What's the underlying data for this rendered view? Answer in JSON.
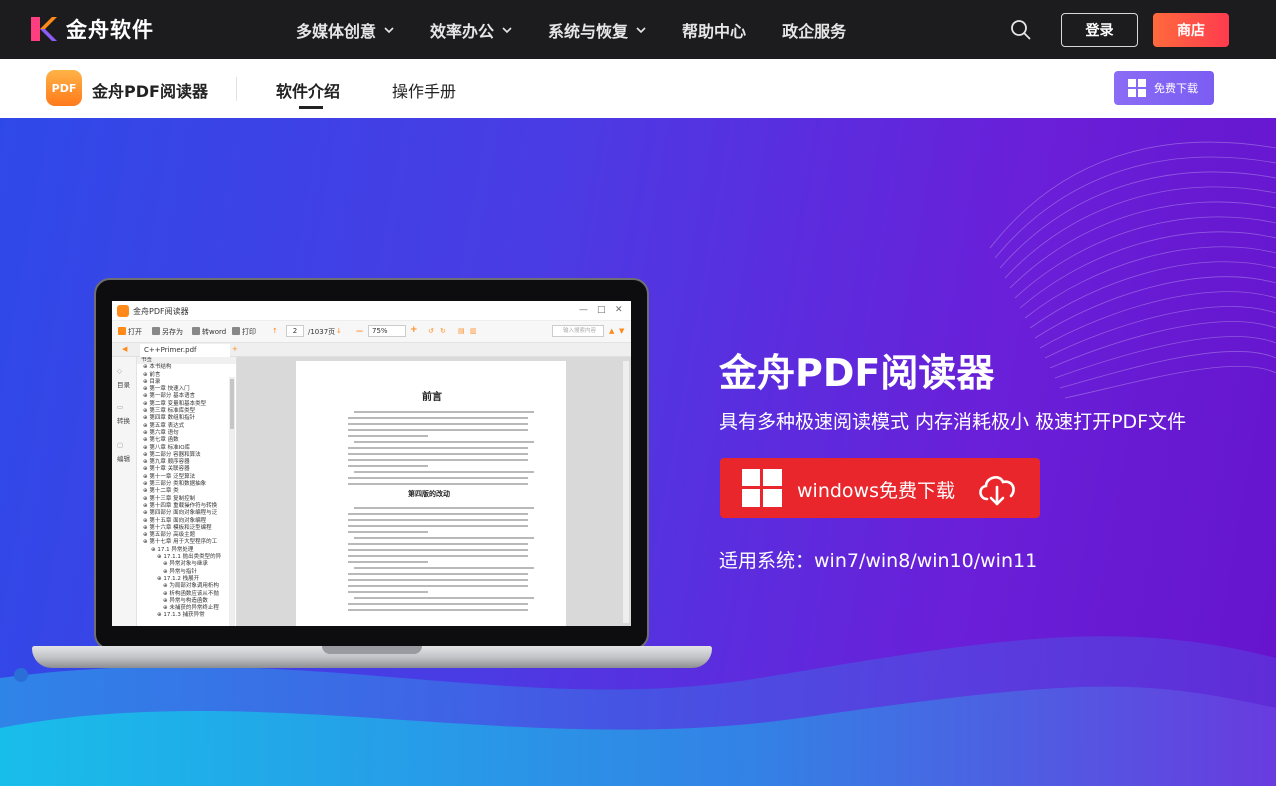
{
  "brand": {
    "name": "金舟软件"
  },
  "top_nav": {
    "items": [
      {
        "label": "多媒体创意",
        "has_dropdown": true
      },
      {
        "label": "效率办公",
        "has_dropdown": true
      },
      {
        "label": "系统与恢复",
        "has_dropdown": true
      },
      {
        "label": "帮助中心",
        "has_dropdown": false
      },
      {
        "label": "政企服务",
        "has_dropdown": false
      }
    ],
    "login_label": "登录",
    "store_label": "商店"
  },
  "sub_nav": {
    "product_icon_text": "PDF",
    "product_name": "金舟PDF阅读器",
    "tabs": [
      {
        "label": "软件介绍",
        "active": true
      },
      {
        "label": "操作手册",
        "active": false
      }
    ],
    "download_label": "免费下载"
  },
  "hero": {
    "title": "金舟PDF阅读器",
    "subtitle": "具有多种极速阅读模式 内存消耗极小 极速打开PDF文件",
    "download_label": "windows免费下载",
    "os_support": "适用系统：win7/win8/win10/win11"
  },
  "app_preview": {
    "title": "金舟PDF阅读器",
    "toolbar": {
      "open": "打开",
      "save_as": "另存为",
      "to_word": "转word",
      "print": "打印",
      "page": "2",
      "page_total": "/1037页",
      "zoom": "75%",
      "search_placeholder": "输入搜索内容"
    },
    "tab": "C++Primer.pdf",
    "side": [
      "目录",
      "转换",
      "编辑"
    ],
    "tree_header": "书签",
    "tree": [
      "本书结构",
      "前言",
      "目录",
      "第一章 快速入门",
      "第一部分 基本语言",
      "第二章 变量和基本类型",
      "第三章 标准库类型",
      "第四章 数组和指针",
      "第五章 表达式",
      "第六章 语句",
      "第七章 函数",
      "第八章 标准IO库",
      "第二部分 容器和算法",
      "第九章 顺序容器",
      "第十章 关联容器",
      "第十一章 泛型算法",
      "第三部分 类和数据抽象",
      "第十二章 类",
      "第十三章 复制控制",
      "第十四章 重载操作符与转换",
      "第四部分 面向对象编程与泛",
      "第十五章 面向对象编程",
      "第十六章 模板和泛型编程",
      "第五部分 高级主题",
      "第十七章 用于大型程序的工",
      "17.1 异常处理",
      "17.1.1 抛出类类型的异",
      "异常对象与继承",
      "异常与指针",
      "17.1.2 栈展开",
      "为局部对象调用析构",
      "析构函数应该从不抛",
      "异常与构造函数",
      "未捕获的异常终止程",
      "17.1.3 捕获异常"
    ],
    "page_heading": "前言",
    "page_subheading": "第四版的改动"
  }
}
